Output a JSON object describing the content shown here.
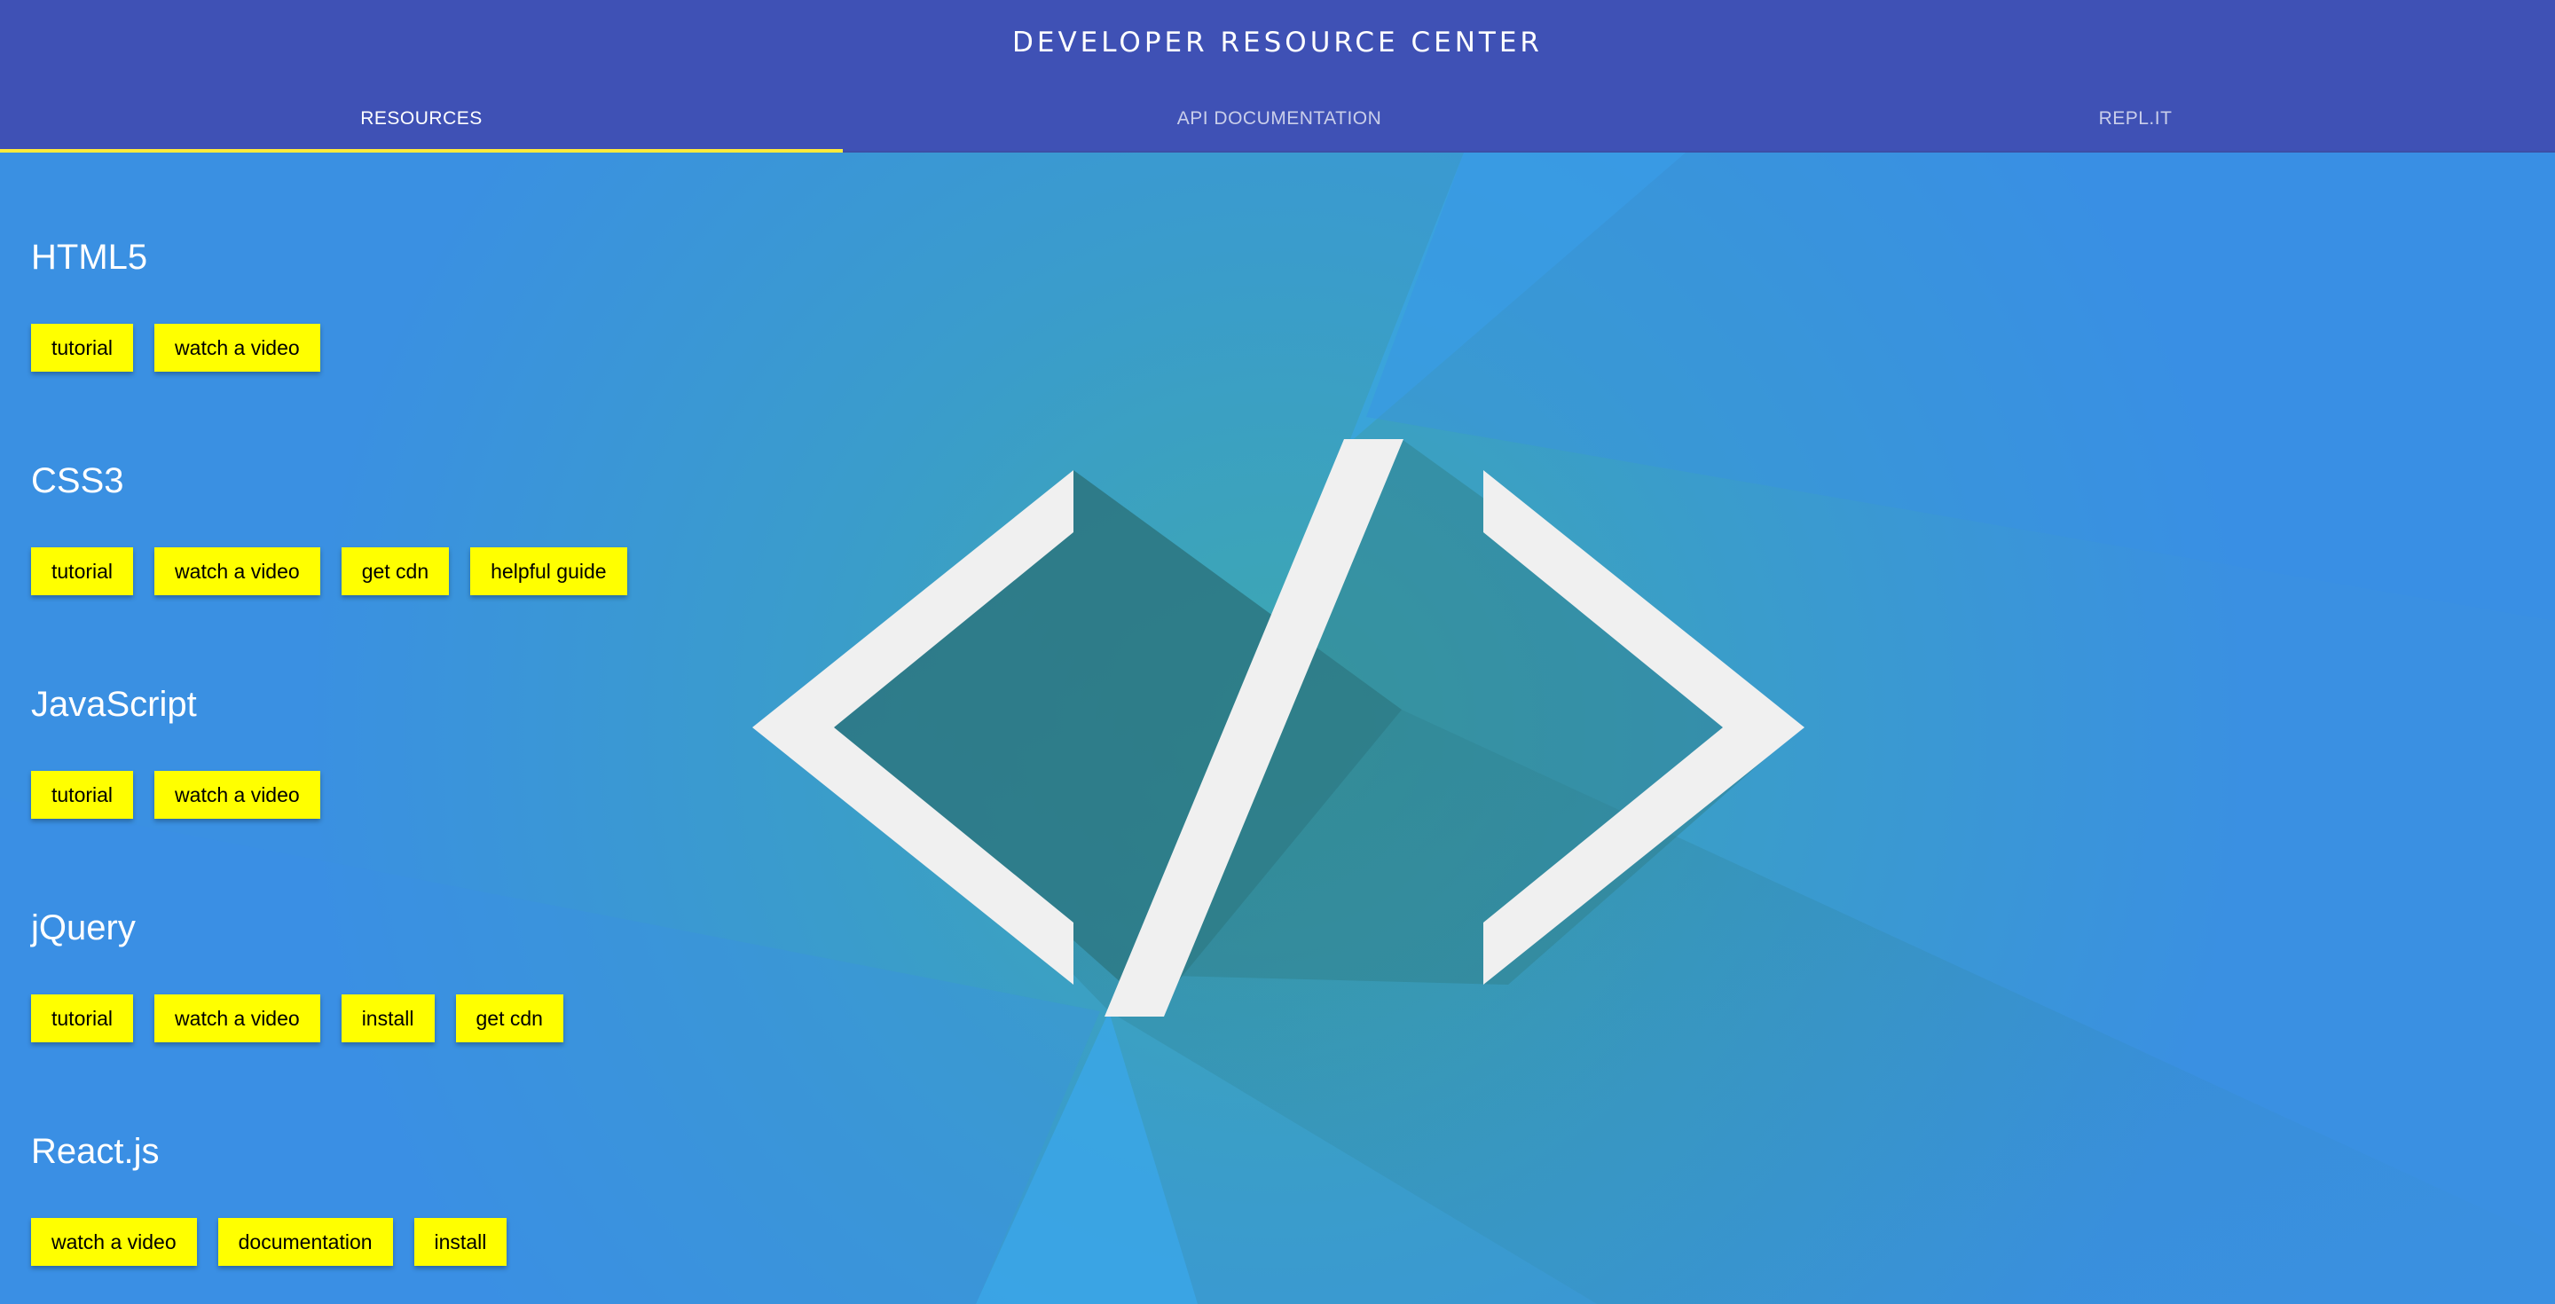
{
  "header": {
    "title": "DEVELOPER RESOURCE CENTER",
    "tabs": [
      {
        "label": "RESOURCES",
        "active": true
      },
      {
        "label": "API DOCUMENTATION",
        "active": false
      },
      {
        "label": "REPL.IT",
        "active": false
      }
    ]
  },
  "colors": {
    "header": "#3f51b5",
    "tab_indicator": "#ffeb3b",
    "button_bg": "#ffff00",
    "background": "#3a8fe0",
    "logo": "#f0f0f0"
  },
  "background_icon": "code-brackets-icon",
  "sections": [
    {
      "title": "HTML5",
      "buttons": [
        "tutorial",
        "watch a video"
      ]
    },
    {
      "title": "CSS3",
      "buttons": [
        "tutorial",
        "watch a video",
        "get cdn",
        "helpful guide"
      ]
    },
    {
      "title": "JavaScript",
      "buttons": [
        "tutorial",
        "watch a video"
      ]
    },
    {
      "title": "jQuery",
      "buttons": [
        "tutorial",
        "watch a video",
        "install",
        "get cdn"
      ]
    },
    {
      "title": "React.js",
      "buttons": [
        "watch a video",
        "documentation",
        "install"
      ]
    }
  ]
}
